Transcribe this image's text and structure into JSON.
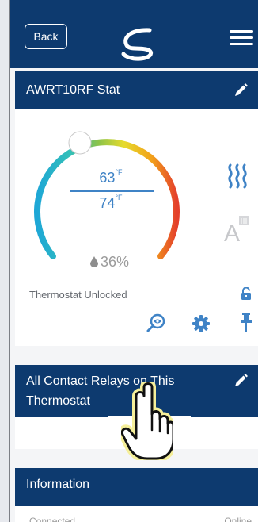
{
  "header": {
    "back_label": "Back"
  },
  "thermostat": {
    "title": "AWRT10RF Stat",
    "setpoint_top": "63",
    "setpoint_bottom": "74",
    "unit": "°F",
    "humidity": "36%",
    "lock_status": "Thermostat Unlocked"
  },
  "relays": {
    "title_line1": "All Contact Relays on This",
    "title_line2": "Thermostat"
  },
  "information": {
    "title": "Information",
    "row_label": "Connected",
    "row_value": "Online"
  },
  "colors": {
    "header_blue": "#0d3a6f",
    "setpoint_blue": "#3f83c6"
  },
  "icons": [
    "logo-icon",
    "menu-icon",
    "edit-icon",
    "heat-mode-icon",
    "auto-mode-icon",
    "lock-icon",
    "find-icon",
    "gear-icon",
    "pin-icon",
    "drop-icon",
    "hand-cursor-icon"
  ]
}
